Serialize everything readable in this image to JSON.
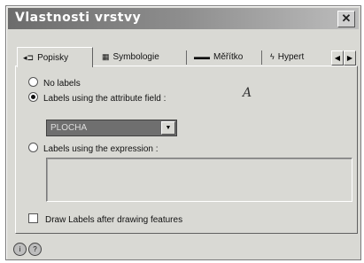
{
  "window": {
    "title": "Vlastnosti vrstvy",
    "close_glyph": "✕"
  },
  "tabs": [
    {
      "label": "Popisky",
      "icon": "tag-icon",
      "glyph": "◂⊐"
    },
    {
      "label": "Symbologie",
      "icon": "table-icon",
      "glyph": "▦"
    },
    {
      "label": "Měřítko",
      "icon": "scale-icon",
      "glyph": "▬▬"
    },
    {
      "label": "Hypert",
      "icon": "lightning-icon",
      "glyph": "ϟ"
    }
  ],
  "tab_scroll": {
    "left": "◀",
    "right": "▶"
  },
  "labels": {
    "no_labels": "No labels",
    "attribute_field": "Labels using the attribute field :",
    "attribute_value": "PLOCHA",
    "expression": "Labels using the expression :",
    "expression_value": "",
    "draw_after": "Draw Labels after drawing features",
    "selected_mode": "attribute_field"
  },
  "annotation": "A",
  "footer_icons": [
    "info-icon",
    "help-icon"
  ]
}
